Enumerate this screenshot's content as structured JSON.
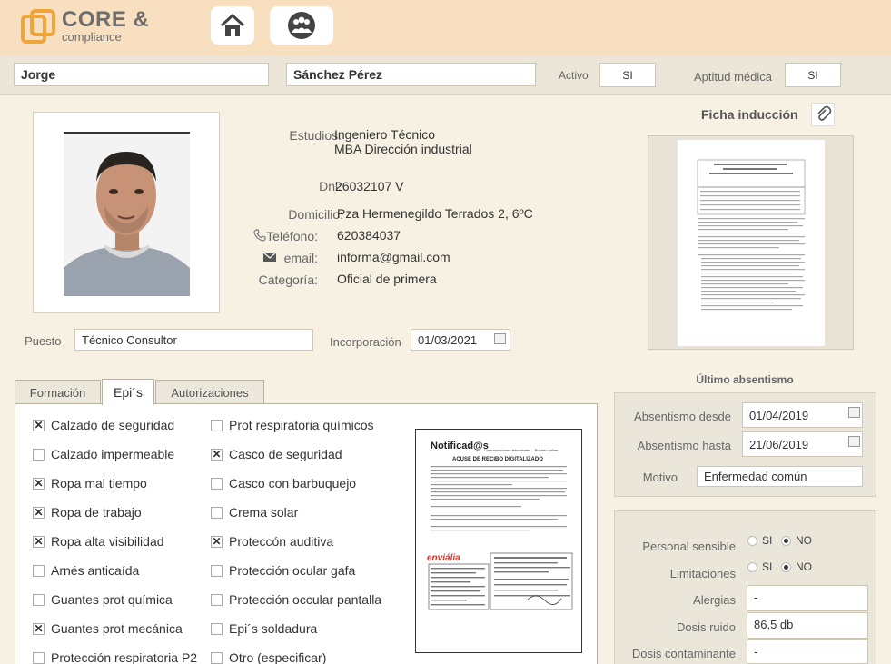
{
  "brand": {
    "name": "CORE &",
    "tagline": "compliance",
    "accent": "#f0a53a"
  },
  "nav": {
    "home_icon": "home-icon",
    "group_icon": "group-icon"
  },
  "employee": {
    "first_name": "Jorge",
    "last_name": "Sánchez Pérez",
    "activo_label": "Activo",
    "activo_value": "SI",
    "aptitud_label": "Aptitud médica",
    "aptitud_value": "SI"
  },
  "details": {
    "estudios_label": "Estudios:",
    "estudios_line1": "Ingeniero Técnico",
    "estudios_line2": "MBA Dirección industrial",
    "dni_label": "Dni:",
    "dni_value": "26032107 V",
    "domicilio_label": "Domicilio:",
    "domicilio_value": "Pza Hermenegildo Terrados 2, 6ºC",
    "telefono_label": "Teléfono:",
    "telefono_value": "620384037",
    "email_label": "email:",
    "email_value": "informa@gmail.com",
    "categoria_label": "Categoría:",
    "categoria_value": "Oficial de primera",
    "puesto_label": "Puesto",
    "puesto_value": "Técnico Consultor",
    "incorporacion_label": "Incorporación",
    "incorporacion_value": "01/03/2021"
  },
  "ficha": {
    "title": "Ficha inducción"
  },
  "tabs": [
    {
      "label": "Formación"
    },
    {
      "label": "Epi´s"
    },
    {
      "label": "Autorizaciones"
    }
  ],
  "epis": [
    {
      "label": "Calzado de seguridad",
      "checked": true
    },
    {
      "label": "Calzado impermeable",
      "checked": false
    },
    {
      "label": "Ropa mal tiempo",
      "checked": true
    },
    {
      "label": "Ropa de trabajo",
      "checked": true
    },
    {
      "label": "Ropa alta visibilidad",
      "checked": true
    },
    {
      "label": "Arnés anticaída",
      "checked": false
    },
    {
      "label": "Guantes prot química",
      "checked": false
    },
    {
      "label": "Guantes prot mecánica",
      "checked": true
    },
    {
      "label": "Protección respiratoria P2",
      "checked": false
    },
    {
      "label": "Prot respiratoria químicos",
      "checked": false
    },
    {
      "label": "Casco de seguridad",
      "checked": true
    },
    {
      "label": "Casco con barbuquejo",
      "checked": false
    },
    {
      "label": "Crema solar",
      "checked": false
    },
    {
      "label": "Proteccón auditiva",
      "checked": true
    },
    {
      "label": "Protección ocular gafa",
      "checked": false
    },
    {
      "label": "Protección occular pantalla",
      "checked": false
    },
    {
      "label": "Epi´s soldadura",
      "checked": false
    },
    {
      "label": "Otro (especificar)",
      "checked": false
    }
  ],
  "receipt": {
    "brand": "Notificad@s",
    "tagline": "Comunicaciones fehacientes – Burofax online",
    "title": "ACUSE DE RECIBO DIGITALIZADO",
    "carrier": "enviália"
  },
  "absentismo": {
    "title": "Último absentismo",
    "desde_label": "Absentismo desde",
    "desde_value": "01/04/2019",
    "hasta_label": "Absentismo hasta",
    "hasta_value": "21/06/2019",
    "motivo_label": "Motivo",
    "motivo_value": "Enfermedad común"
  },
  "medical": {
    "sensible_label": "Personal sensible",
    "limitaciones_label": "Limitaciones",
    "si_label": "SI",
    "no_label": "NO",
    "alergias_label": "Alergias",
    "alergias_value": "-",
    "dosis_ruido_label": "Dosis ruido",
    "dosis_ruido_value": "86,5 db",
    "dosis_contaminante_label": "Dosis contaminante",
    "dosis_contaminante_value": "-"
  }
}
